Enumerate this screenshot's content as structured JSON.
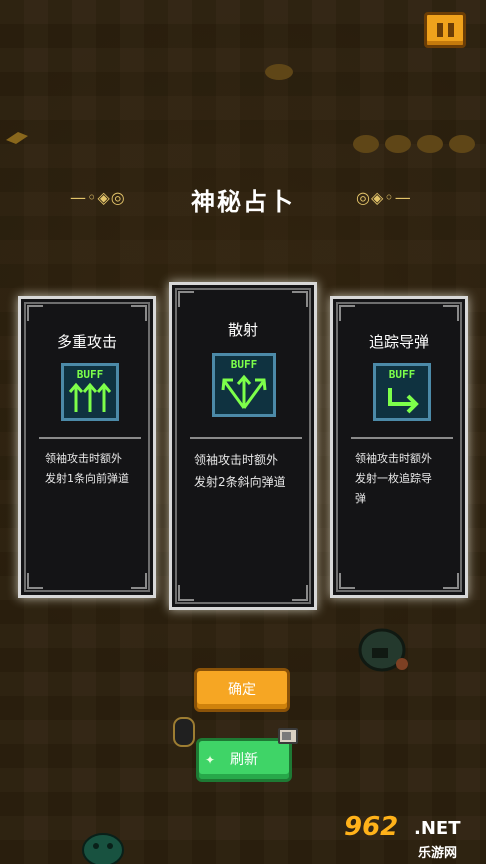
{
  "screen": {
    "title": "神秘占卜",
    "title_ornament_left": "—◦◈◎",
    "title_ornament_right": "◎◈◦—"
  },
  "cards": [
    {
      "name": "多重攻击",
      "badge": "BUFF",
      "desc_line1": "领袖攻击时额外",
      "desc_line2": "发射1条向前弹道",
      "icon": "triple-arrow-up-icon"
    },
    {
      "name": "散射",
      "badge": "BUFF",
      "desc_line1": "领袖攻击时额外",
      "desc_line2": "发射2条斜向弹道",
      "icon": "spread-arrow-icon"
    },
    {
      "name": "追踪导弹",
      "badge": "BUFF",
      "desc_line1": "领袖攻击时额外",
      "desc_line2": "发射一枚追踪导",
      "desc_line3": "弹",
      "icon": "homing-arrow-icon"
    }
  ],
  "buttons": {
    "confirm": "确定",
    "refresh": "刷新"
  },
  "watermark": {
    "number": "962",
    "net": ".NET",
    "site": "乐游网"
  },
  "colors": {
    "accent_orange": "#f6a623",
    "accent_green": "#3fd467",
    "buff_green": "#7dff4a",
    "card_bg": "#141416"
  }
}
